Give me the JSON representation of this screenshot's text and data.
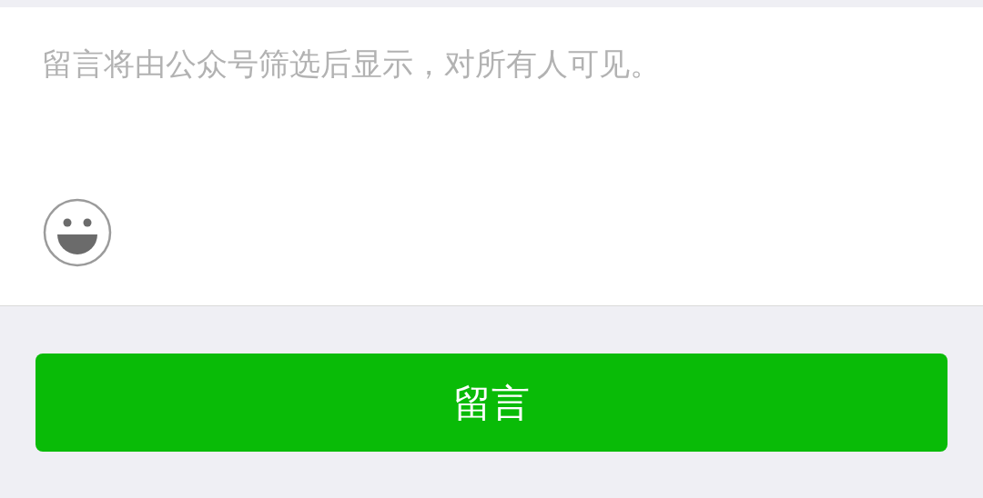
{
  "comment_box": {
    "placeholder": "留言将由公众号筛选后显示，对所有人可见。"
  },
  "submit_button": {
    "label": "留言"
  }
}
